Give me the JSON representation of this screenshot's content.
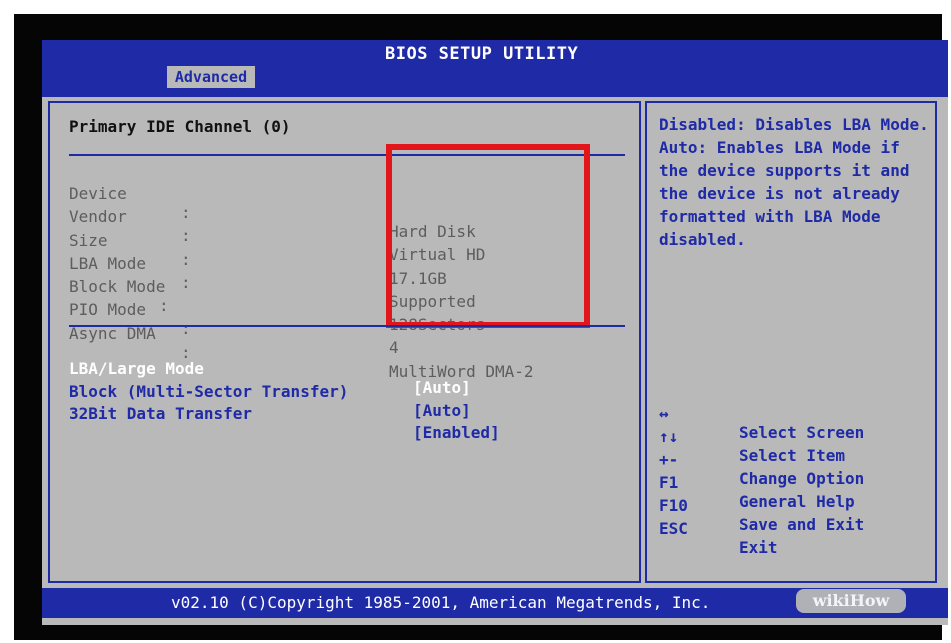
{
  "header": {
    "title": "BIOS SETUP UTILITY",
    "tab": "Advanced"
  },
  "main": {
    "section_title": "Primary IDE Channel (0)",
    "info_rows": [
      {
        "label": "Device",
        "colon": ":",
        "value": "Hard Disk"
      },
      {
        "label": "Vendor",
        "colon": ":",
        "value": "Virtual HD"
      },
      {
        "label": "Size",
        "colon": ":",
        "value": "17.1GB"
      },
      {
        "label": "LBA Mode",
        "colon": ":",
        "value": "Supported"
      },
      {
        "label": "Block Mode",
        "colon": ":",
        "value": "128Sectors"
      },
      {
        "label": "PIO Mode",
        "colon": ":",
        "value": "4"
      },
      {
        "label": "Async DMA",
        "colon": ":",
        "value": "MultiWord DMA-2"
      }
    ],
    "settings": [
      {
        "label": "LBA/Large Mode",
        "value": "[Auto]"
      },
      {
        "label": "Block (Multi-Sector Transfer)",
        "value": "[Auto]"
      },
      {
        "label": "32Bit Data Transfer",
        "value": "[Enabled]"
      }
    ]
  },
  "help": {
    "description": "Disabled: Disables LBA Mode.\nAuto: Enables LBA Mode if the device supports it and the device is not already formatted with LBA Mode disabled.",
    "keys": [
      {
        "key": "↔",
        "desc": "Select Screen"
      },
      {
        "key": "↑↓",
        "desc": "Select Item"
      },
      {
        "key": "+-",
        "desc": "Change Option"
      },
      {
        "key": "F1",
        "desc": "General Help"
      },
      {
        "key": "F10",
        "desc": "Save and Exit"
      },
      {
        "key": "ESC",
        "desc": "Exit"
      }
    ]
  },
  "footer": {
    "copyright": "v02.10 (C)Copyright 1985-2001, American Megatrends, Inc.",
    "watermark": "wikiHow"
  },
  "colors": {
    "bios_blue": "#1f2aa6",
    "panel_gray": "#b9b9b9",
    "highlight_red": "#e2151a"
  }
}
